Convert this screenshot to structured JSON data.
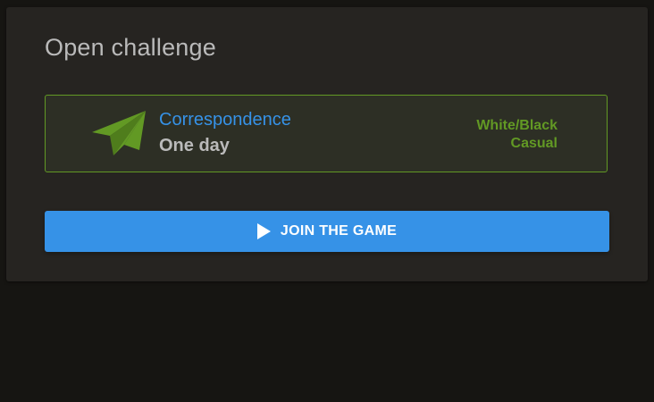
{
  "title": "Open challenge",
  "challenge": {
    "icon": "paper-plane-icon",
    "variant": "Correspondence",
    "speed": "One day",
    "color_choice": "White/Black",
    "mode": "Casual"
  },
  "join_button": {
    "label": "JOIN THE GAME",
    "icon": "play-icon"
  },
  "colors": {
    "background": "#161512",
    "card": "#262421",
    "accent_green": "#629924",
    "accent_blue": "#3692e7",
    "text": "#bababa"
  }
}
